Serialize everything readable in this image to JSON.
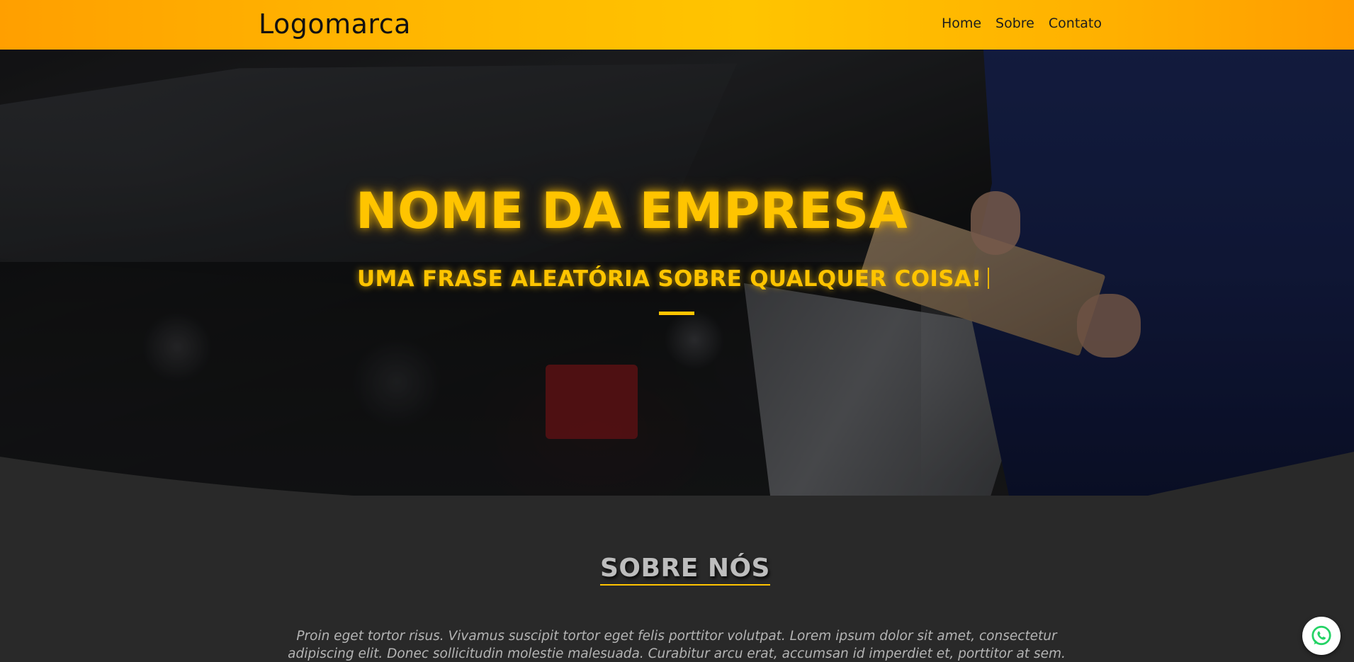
{
  "navbar": {
    "logo": "Logomarca",
    "links": [
      {
        "label": "Home"
      },
      {
        "label": "Sobre"
      },
      {
        "label": "Contato"
      }
    ],
    "gradient_colors": [
      "#ff9f00",
      "#ffc400",
      "#ff9d00"
    ]
  },
  "hero": {
    "title": "NOME DA EMPRESA",
    "subtitle": "UMA FRASE ALEATÓRIA SOBRE QUALQUER COISA!",
    "accent_color": "#ffc400",
    "background_image": "mechanic-with-clipboard-car-engine-photo"
  },
  "about": {
    "title": "SOBRE NÓS",
    "text": "Proin eget tortor risus. Vivamus suscipit tortor eget felis porttitor volutpat. Lorem ipsum dolor sit amet, consectetur adipiscing elit. Donec sollicitudin molestie malesuada. Curabitur arcu erat, accumsan id imperdiet et, porttitor at sem.",
    "background_color": "#292929"
  },
  "whatsapp": {
    "icon": "whatsapp-icon",
    "color": "#25d366"
  }
}
